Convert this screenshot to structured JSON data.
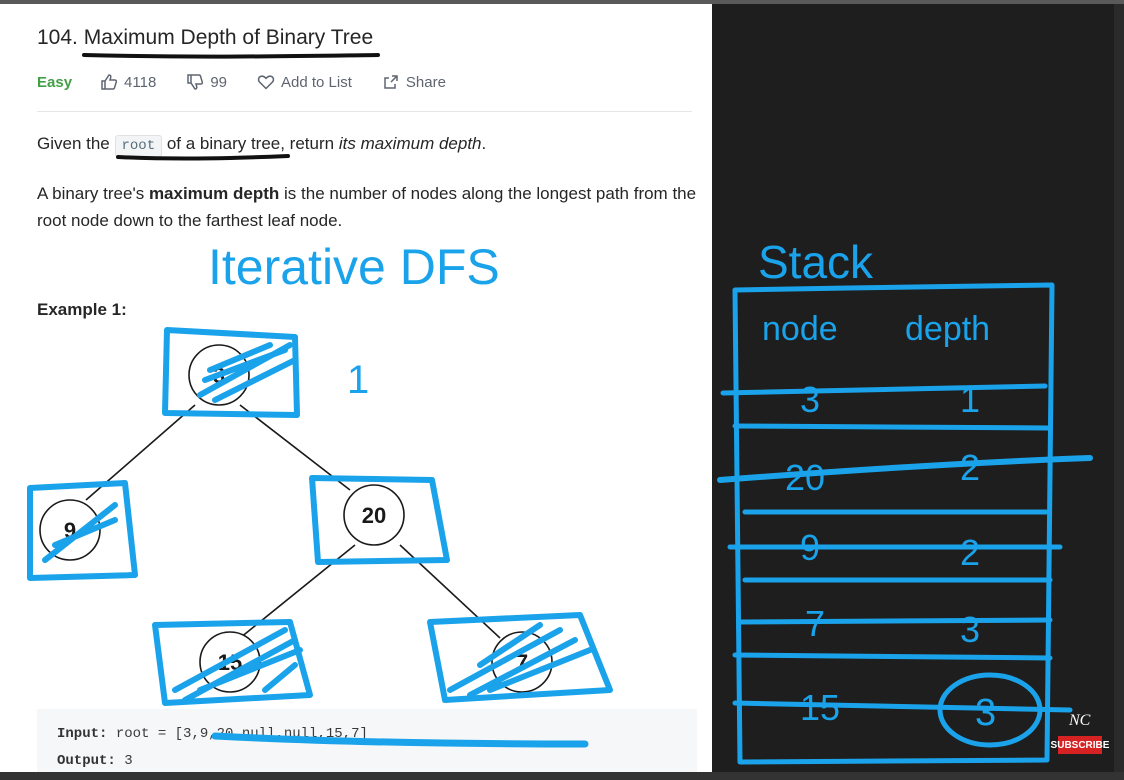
{
  "problem": {
    "title": "104. Maximum Depth of Binary Tree",
    "difficulty": "Easy",
    "likes": "4118",
    "dislikes": "99",
    "add_to_list": "Add to List",
    "share": "Share"
  },
  "description": {
    "p1_before": "Given the",
    "p1_code": "root",
    "p1_mid": "of a binary tree, return",
    "p1_em": "its maximum depth",
    "p1_end": ".",
    "p2_before": "A binary tree's",
    "p2_bold": "maximum depth",
    "p2_after": "is the number of nodes along the longest path from the root node down to the farthest leaf node."
  },
  "example": {
    "heading": "Example 1:",
    "input_label": "Input:",
    "input_value": "root = [3,9,20,null,null,15,7]",
    "output_label": "Output:",
    "output_value": "3"
  },
  "tree": {
    "nodes": [
      "3",
      "9",
      "20",
      "15",
      "7"
    ]
  },
  "annotations": {
    "heading": "Iterative DFS",
    "root_depth": "1",
    "stack_title": "Stack",
    "col_node": "node",
    "col_depth": "depth",
    "rows": [
      {
        "node": "3",
        "depth": "1"
      },
      {
        "node": "20",
        "depth": "2"
      },
      {
        "node": "9",
        "depth": "2"
      },
      {
        "node": "7",
        "depth": "3"
      },
      {
        "node": "15",
        "depth": "3"
      }
    ]
  },
  "channel": {
    "logo": "NC",
    "subscribe": "SUBSCRIBE"
  },
  "colors": {
    "ink": "#1aa3ea",
    "easy": "#43a047"
  }
}
